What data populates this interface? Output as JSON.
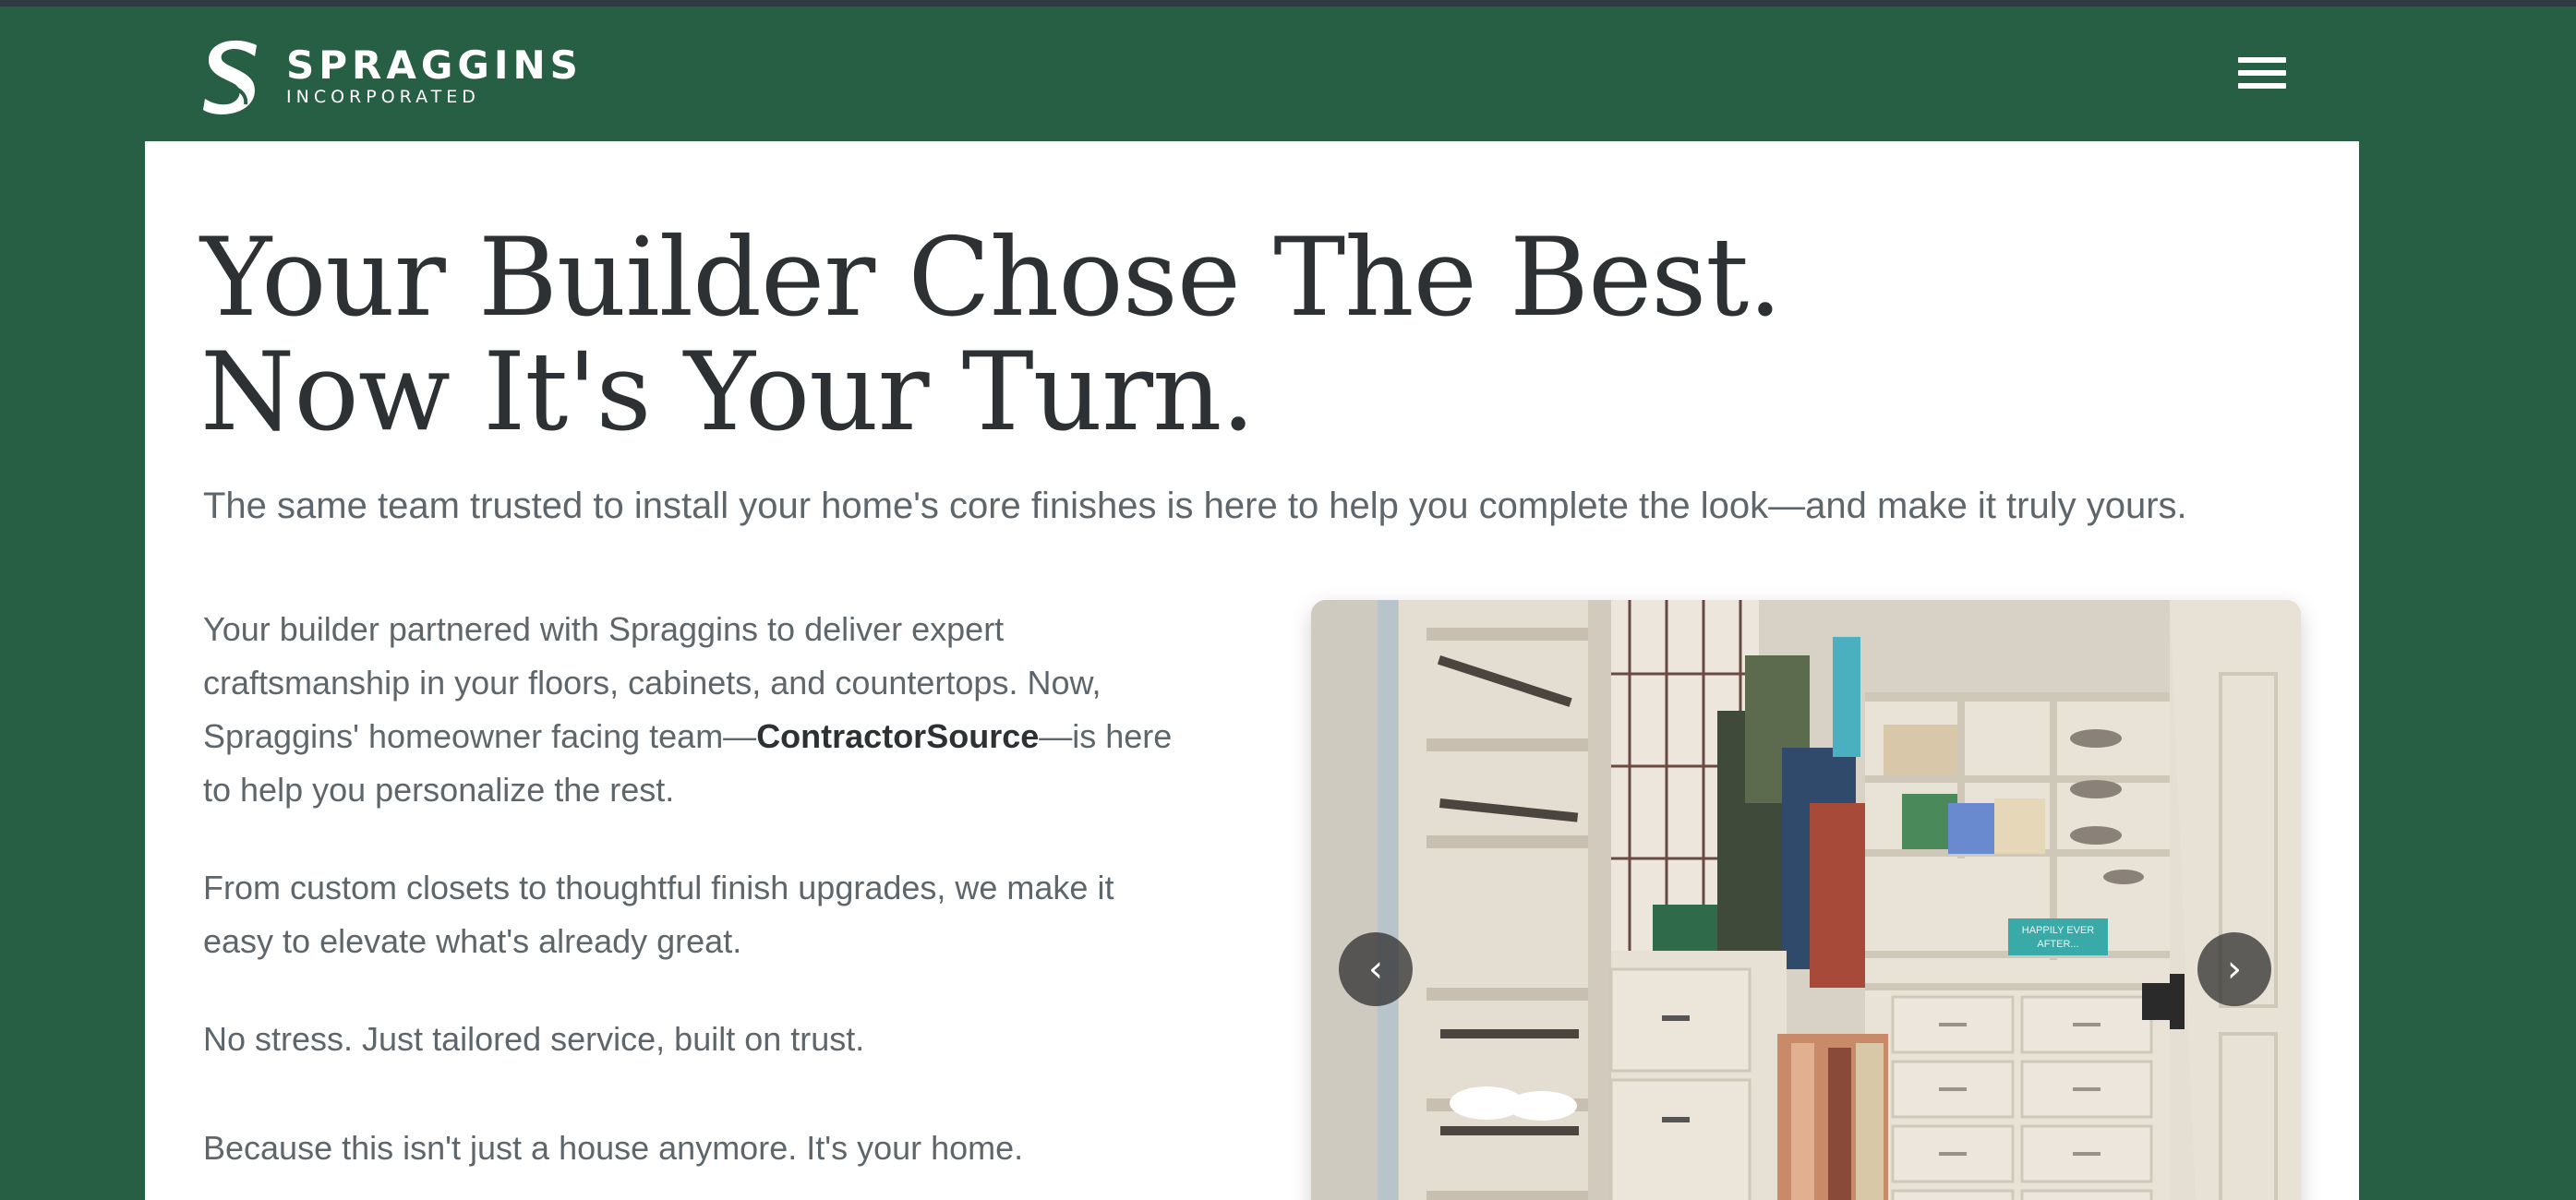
{
  "header": {
    "logo_name": "SPRAGGINS",
    "logo_sub": "INCORPORATED",
    "menu_icon": "hamburger-menu-icon"
  },
  "hero": {
    "headline_line1": "Your Builder Chose The Best.",
    "headline_line2": "Now It's Your Turn.",
    "subhead": "The same team trusted to install your home's core finishes is here to help you complete the look—and make it truly yours."
  },
  "body": {
    "p1_before": "Your builder partnered with Spraggins to deliver expert craftsmanship in your floors, cabinets, and countertops. Now, Spraggins' homeowner facing team—",
    "p1_strong": "ContractorSource",
    "p1_after": "—is here to help you personalize the rest.",
    "p2": "From custom closets to thoughtful finish upgrades, we make it easy to elevate what's already great.",
    "p3": "No stress. Just tailored service, built on trust.",
    "tagline": "Because this isn't just a house anymore. It's your home."
  },
  "carousel": {
    "image_sign": "HAPPILY EVER AFTER...",
    "prev_label": "‹",
    "next_label": "›"
  },
  "colors": {
    "brand_green": "#275f44",
    "top_bar": "#2f3b42",
    "heading_text": "#2d3133",
    "body_text": "#5f666b"
  }
}
